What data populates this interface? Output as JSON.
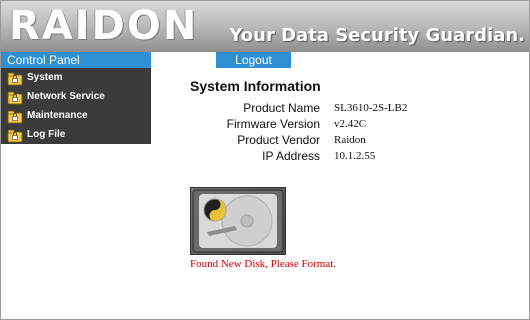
{
  "header": {
    "logo_text": "RAIDON",
    "tagline": "Your Data Security Guardian."
  },
  "topbar": {
    "control_panel_label": "Control Panel",
    "logout_label": "Logout"
  },
  "sidebar": {
    "items": [
      {
        "label": "System",
        "icon": "folder-lock-icon"
      },
      {
        "label": "Network Service",
        "icon": "folder-lock-icon"
      },
      {
        "label": "Maintenance",
        "icon": "folder-lock-icon"
      },
      {
        "label": "Log File",
        "icon": "folder-lock-icon"
      }
    ]
  },
  "main": {
    "title": "System Information",
    "info": [
      {
        "label": "Product Name",
        "value": "SL3610-2S-LB2"
      },
      {
        "label": "Firmware Version",
        "value": "v2.42C"
      },
      {
        "label": "Product Vendor",
        "value": "Raidon"
      },
      {
        "label": "IP Address",
        "value": "10.1.2.55"
      }
    ],
    "disk_icon": "hard-disk-icon",
    "notice": "Found New Disk, Please Format."
  },
  "colors": {
    "accent_blue": "#2f8fd3",
    "sidebar_bg": "#3b3b3b",
    "notice_red": "#cc0000"
  }
}
